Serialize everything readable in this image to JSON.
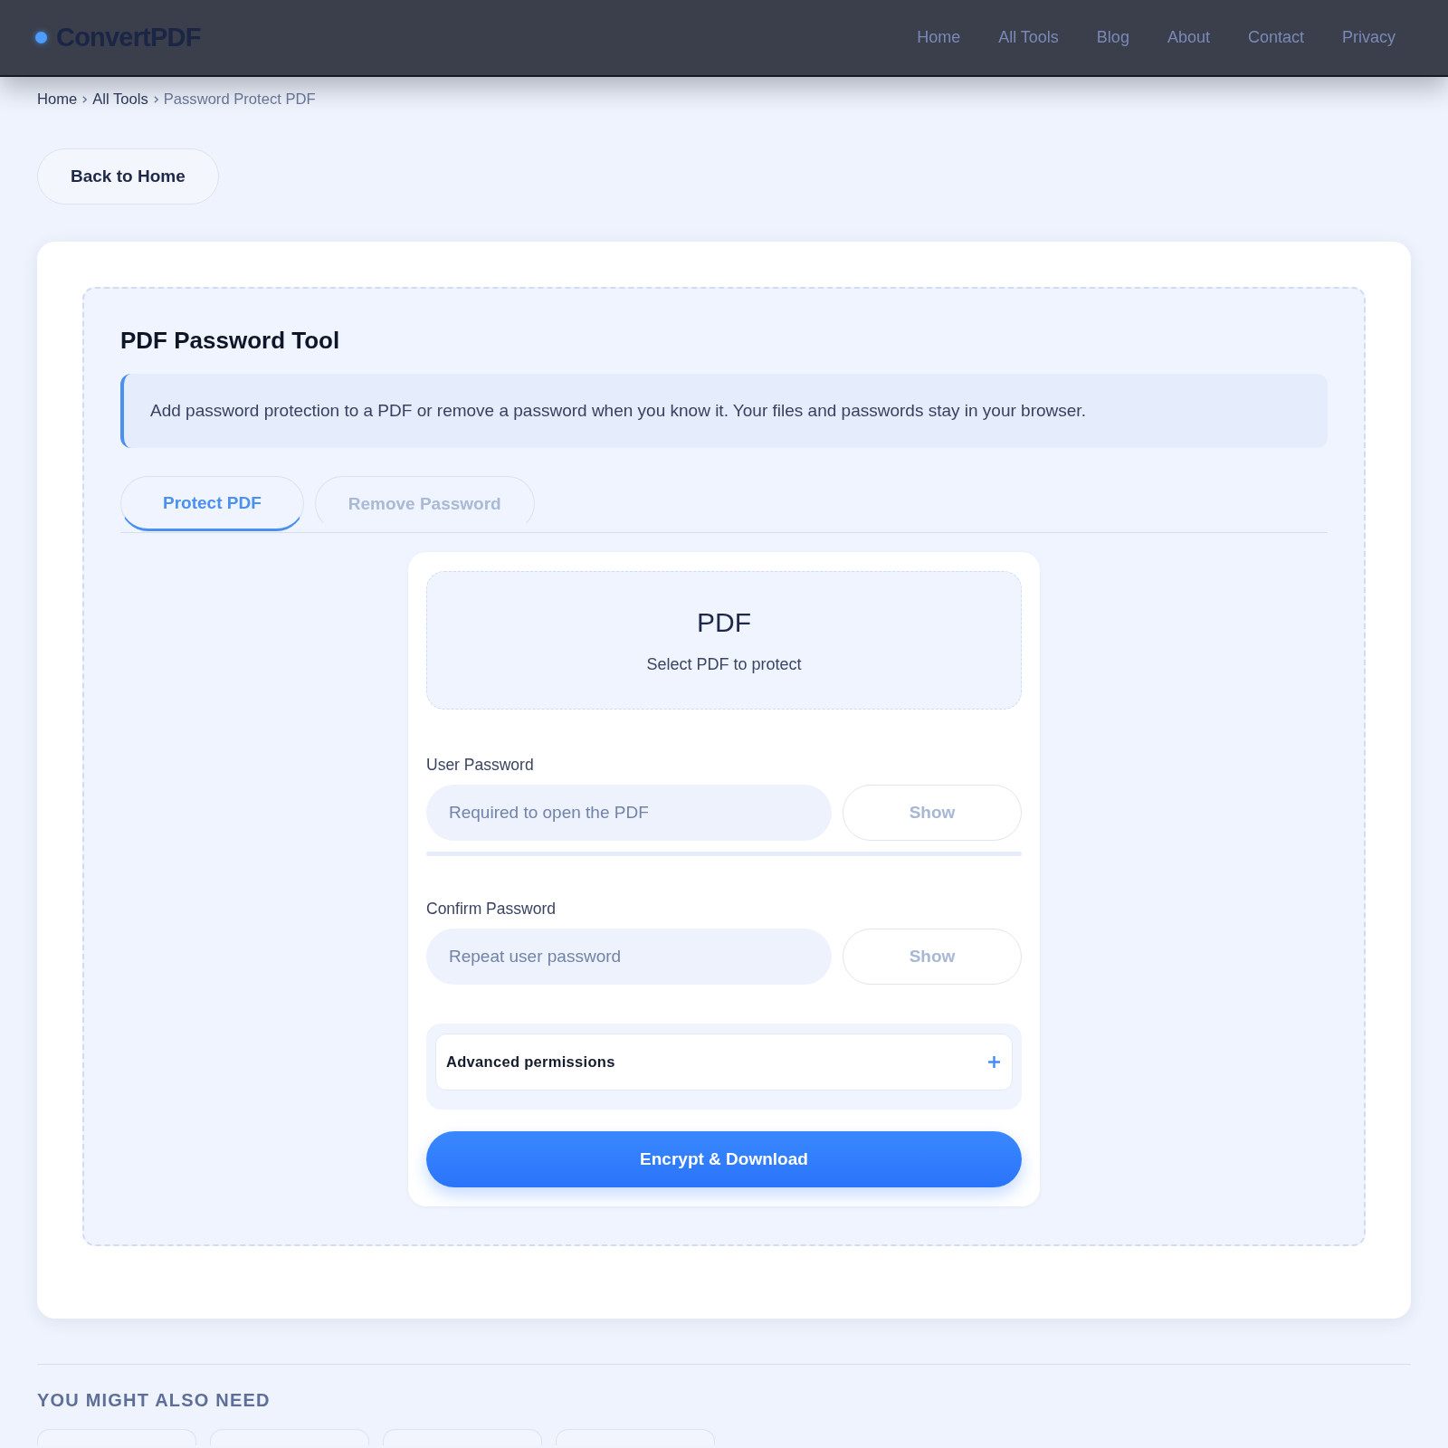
{
  "header": {
    "logo": "ConvertPDF",
    "nav": [
      {
        "label": "Home"
      },
      {
        "label": "All Tools"
      },
      {
        "label": "Blog"
      },
      {
        "label": "About"
      },
      {
        "label": "Contact"
      },
      {
        "label": "Privacy"
      }
    ]
  },
  "breadcrumb": [
    {
      "label": "Home",
      "current": false
    },
    {
      "label": "All Tools",
      "current": false
    },
    {
      "label": "Password Protect PDF",
      "current": true
    }
  ],
  "back_button": {
    "label": "Back to Home"
  },
  "tool": {
    "title": "PDF Password Tool",
    "info": "Add password protection to a PDF or remove a password when you know it. Your files and passwords stay in your browser.",
    "tabs": [
      {
        "label": "Protect PDF",
        "selected": true
      },
      {
        "label": "Remove Password",
        "selected": false
      }
    ],
    "drop_zone": {
      "file_type": "PDF",
      "hint": "Select PDF to protect"
    },
    "fields": [
      {
        "label": "User Password",
        "placeholder": "Required to open the PDF",
        "toggle": "Show",
        "strength_meter": true
      },
      {
        "label": "Confirm Password",
        "placeholder": "Repeat user password",
        "toggle": "Show"
      }
    ],
    "advanced": {
      "label": "Advanced permissions",
      "expanded": false
    },
    "submit": {
      "label": "Encrypt & Download"
    }
  },
  "related": {
    "heading": "YOU MIGHT ALSO NEED"
  }
}
